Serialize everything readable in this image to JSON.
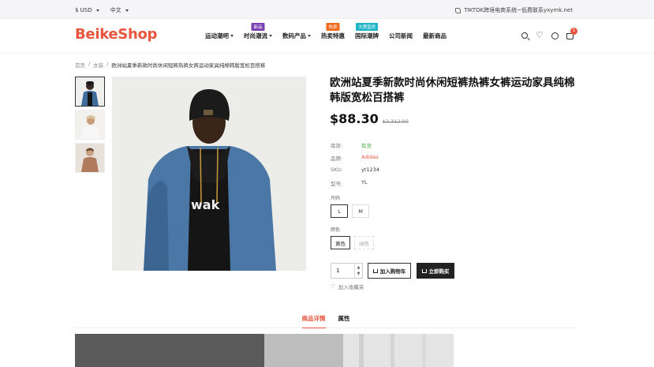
{
  "topbar": {
    "currency": "$ USD",
    "language": "中文",
    "contact": "TIKTOK跨境电商系统~低费联系yxymk.net"
  },
  "header": {
    "logo": "BeikeShop",
    "nav": [
      {
        "label": "运动潮吧",
        "dropdown": true,
        "badge": "",
        "badge_color": ""
      },
      {
        "label": "时尚潮流",
        "dropdown": true,
        "badge": "新品",
        "badge_color": "#7a3fb0"
      },
      {
        "label": "数码产品",
        "dropdown": true,
        "badge": "",
        "badge_color": ""
      },
      {
        "label": "热卖特惠",
        "dropdown": false,
        "badge": "热卖",
        "badge_color": "#f06a1e"
      },
      {
        "label": "国际潮牌",
        "dropdown": false,
        "badge": "大牌直供",
        "badge_color": "#1fb5c7"
      },
      {
        "label": "公司新闻",
        "dropdown": false,
        "badge": "",
        "badge_color": ""
      },
      {
        "label": "最新商品",
        "dropdown": false,
        "badge": "",
        "badge_color": ""
      }
    ],
    "cart_count": "1"
  },
  "breadcrumb": {
    "home": "首页",
    "category": "女装",
    "current": "欧洲站夏季新款时尚休闲短裤热裤女裤运动家具纯棉韩版宽松百搭裤"
  },
  "product": {
    "title": "欧洲站夏季新款时尚休闲短裤热裤女裤运动家具纯棉韩版宽松百搭裤",
    "price": "$88.30",
    "old_price": "$2,312.00",
    "attrs": [
      {
        "key": "库存:",
        "value": "有货",
        "kind": "stock"
      },
      {
        "key": "品牌:",
        "value": "Adidas",
        "kind": "brand"
      },
      {
        "key": "SKU:",
        "value": "yt1234",
        "kind": ""
      },
      {
        "key": "型号:",
        "value": "YL",
        "kind": ""
      }
    ],
    "size_label": "尺码",
    "sizes": [
      "L",
      "M"
    ],
    "color_label": "颜色",
    "colors": [
      "黄色",
      "绿色"
    ],
    "quantity": "1",
    "add_to_cart": "加入购物车",
    "buy_now": "立即购买",
    "wishlist": "加入收藏夹"
  },
  "tabs": [
    "商品详情",
    "属性"
  ],
  "colors": {
    "accent": "#e8543e",
    "stock": "#3cab3b"
  }
}
